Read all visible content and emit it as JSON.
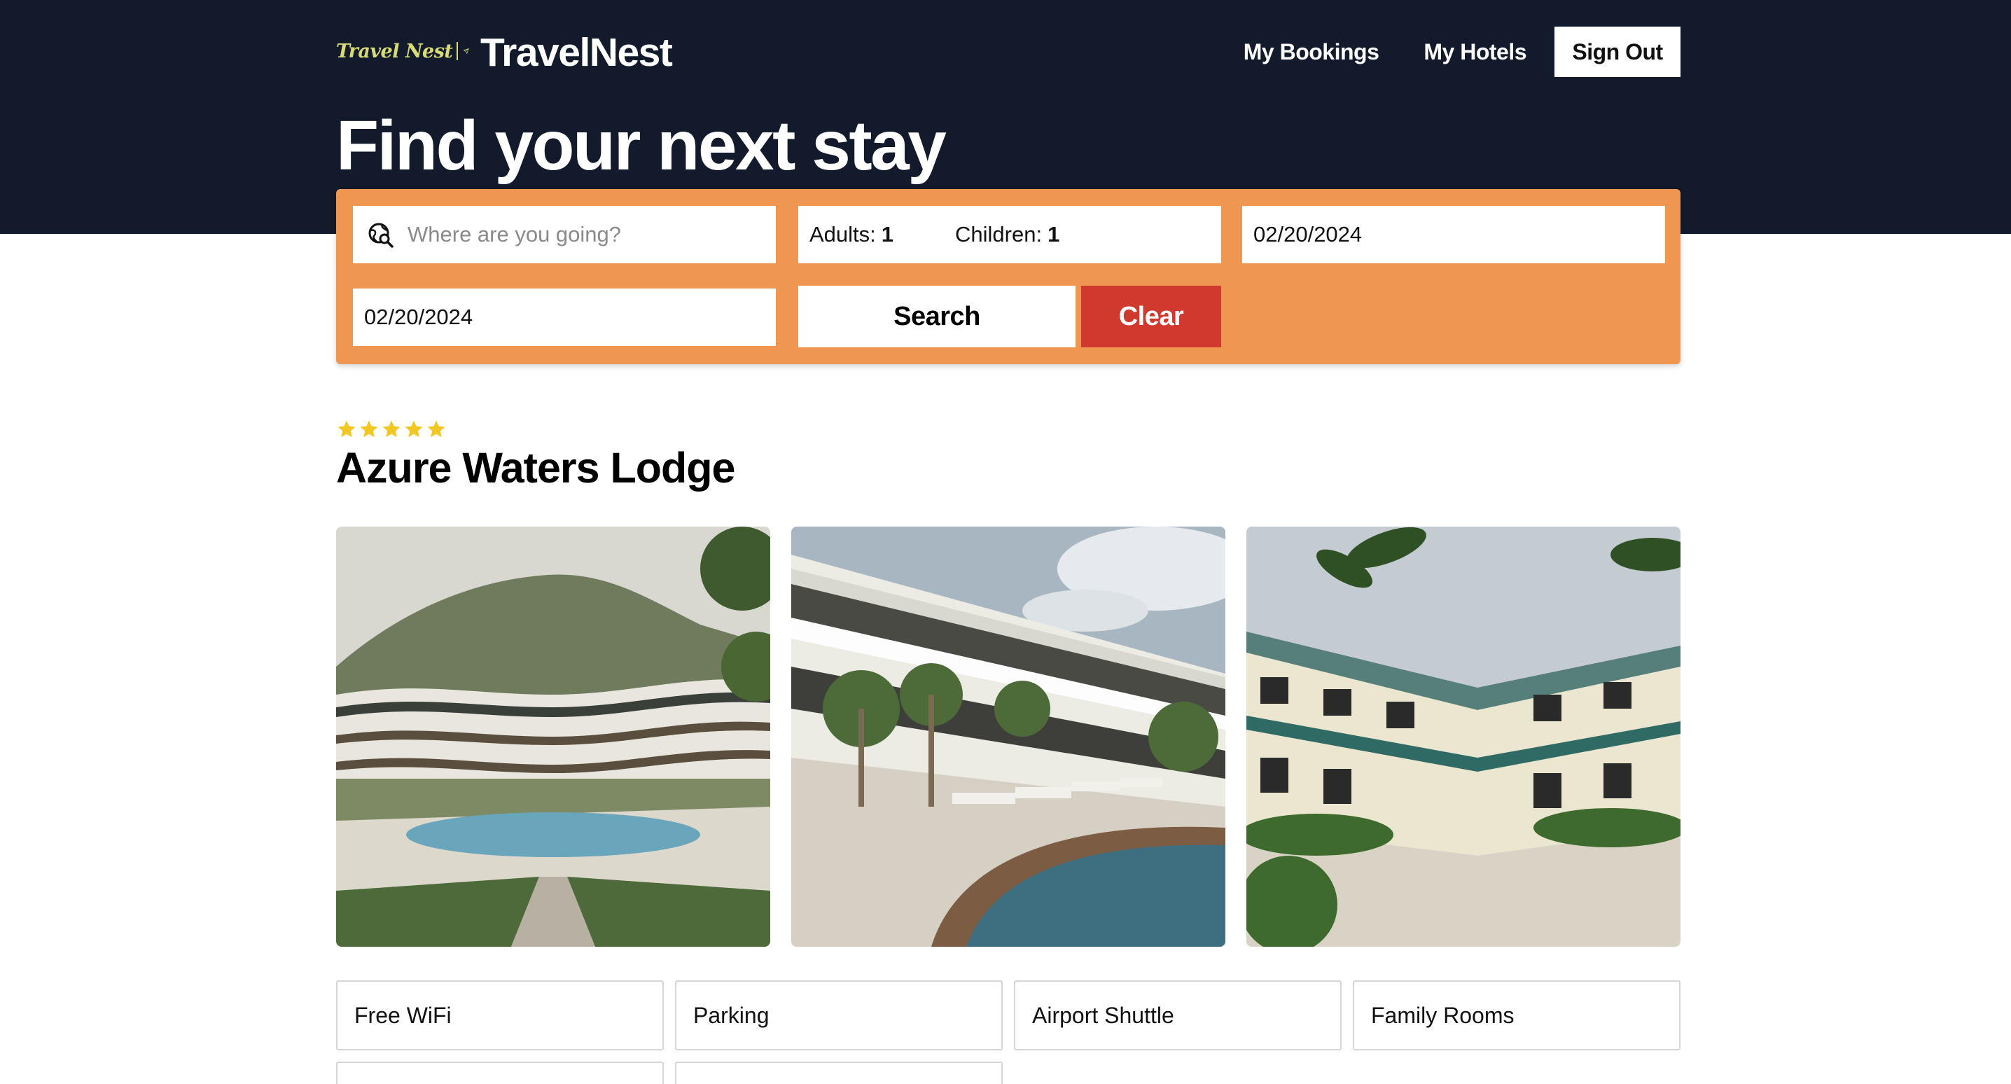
{
  "header": {
    "logo_text": "Travel Nest",
    "brand": "TravelNest",
    "nav": [
      {
        "label": "My Bookings"
      },
      {
        "label": "My Hotels"
      }
    ],
    "sign_out_label": "Sign Out",
    "hero_title": "Find your next stay"
  },
  "search": {
    "destination_placeholder": "Where are you going?",
    "adults_label": "Adults:",
    "adults_value": "1",
    "children_label": "Children:",
    "children_value": "1",
    "check_in": "02/20/2024",
    "check_out": "02/20/2024",
    "search_label": "Search",
    "clear_label": "Clear"
  },
  "hotel": {
    "star_rating": 5,
    "name": "Azure Waters Lodge",
    "photos": [
      {
        "icon": "hotel-courtyard-pool-photo"
      },
      {
        "icon": "hotel-poolside-loungers-photo"
      },
      {
        "icon": "hotel-garden-courtyard-photo"
      }
    ],
    "facilities": [
      "Free WiFi",
      "Parking",
      "Airport Shuttle",
      "Family Rooms",
      "",
      ""
    ]
  },
  "colors": {
    "header_bg": "#131a2b",
    "search_panel": "#ef9651",
    "clear_button": "#d0392d",
    "star": "#f3c623",
    "logo_accent": "#d8dc78"
  }
}
